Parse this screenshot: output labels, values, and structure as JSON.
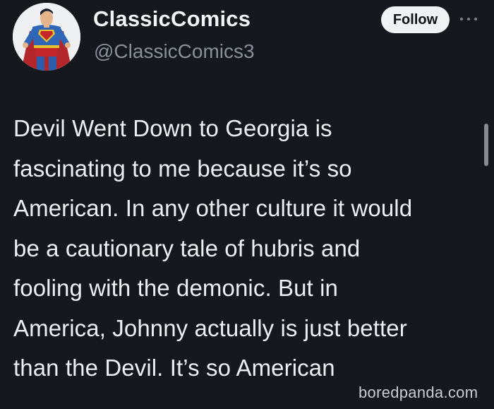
{
  "profile": {
    "display_name": "ClassicComics",
    "handle": "@ClassicComics3",
    "avatar_icon": "superman-avatar"
  },
  "actions": {
    "follow_label": "Follow",
    "more_icon": "more-dots-icon"
  },
  "tweet": {
    "lines": [
      "Devil Went Down to Georgia is",
      "fascinating to me because it’s so",
      "American. In any other culture it would",
      "be a cautionary tale of hubris and",
      "fooling with the demonic. But in",
      "America, Johnny actually is just better",
      "than the Devil. It’s so American"
    ]
  },
  "watermark": {
    "text": "boredpanda.com"
  },
  "colors": {
    "background": "#15181d",
    "text": "#eceef1",
    "handle": "#8a9099",
    "follow_button_bg": "#eff1f3"
  }
}
